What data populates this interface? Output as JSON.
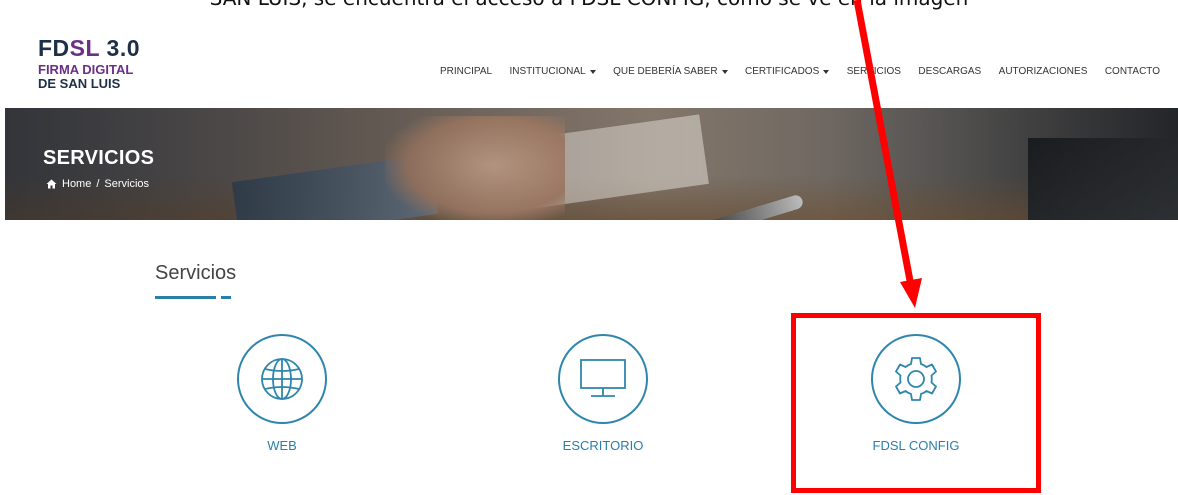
{
  "top_text": "SAN LUIS, se encuentra el acceso a FDSL CONFIG, como se ve en la imagen",
  "logo": {
    "main_a": "FD",
    "main_b": "SL",
    "main_c": " 3.0",
    "line1": "FIRMA DIGITAL",
    "line2": "DE SAN LUIS"
  },
  "nav": {
    "items": [
      {
        "label": "PRINCIPAL",
        "dropdown": false
      },
      {
        "label": "INSTITUCIONAL",
        "dropdown": true
      },
      {
        "label": "QUE DEBERÍA SABER",
        "dropdown": true
      },
      {
        "label": "CERTIFICADOS",
        "dropdown": true
      },
      {
        "label": "SERVICIOS",
        "dropdown": false
      },
      {
        "label": "DESCARGAS",
        "dropdown": false
      },
      {
        "label": "AUTORIZACIONES",
        "dropdown": false
      },
      {
        "label": "CONTACTO",
        "dropdown": false
      }
    ]
  },
  "banner": {
    "title": "SERVICIOS",
    "breadcrumb_home": "Home",
    "breadcrumb_sep": "/",
    "breadcrumb_current": "Servicios"
  },
  "section": {
    "title": "Servicios"
  },
  "services": [
    {
      "label": "WEB",
      "icon": "globe-icon"
    },
    {
      "label": "ESCRITORIO",
      "icon": "monitor-icon"
    },
    {
      "label": "FDSL CONFIG",
      "icon": "gear-icon"
    }
  ],
  "colors": {
    "accent_blue": "#2a7fa8",
    "brand_purple": "#6b2f86",
    "brand_navy": "#1d3048",
    "annotation_red": "#ff0000"
  }
}
